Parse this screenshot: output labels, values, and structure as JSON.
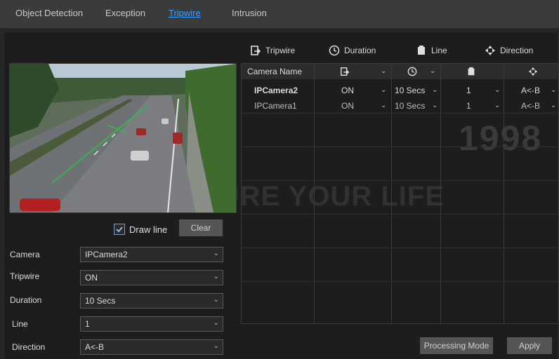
{
  "tabs": [
    "Object Detection",
    "Exception",
    "Tripwire",
    "Intrusion"
  ],
  "active_tab": "Tripwire",
  "draw_line": {
    "label": "Draw line",
    "checked": true
  },
  "clear_label": "Clear",
  "form": {
    "camera": {
      "label": "Camera",
      "value": "IPCamera2"
    },
    "tripwire": {
      "label": "Tripwire",
      "value": "ON"
    },
    "duration": {
      "label": "Duration",
      "value": "10 Secs"
    },
    "line": {
      "label": "Line",
      "value": "1"
    },
    "direction": {
      "label": "Direction",
      "value": "A<-B"
    }
  },
  "columns": {
    "tripwire": "Tripwire",
    "duration": "Duration",
    "line": "Line",
    "direction": "Direction"
  },
  "table": {
    "camera_name_header": "Camera Name",
    "rows": [
      {
        "camera": "IPCamera2",
        "tripwire": "ON",
        "duration": "10 Secs",
        "line": "1",
        "direction": "A<-B"
      },
      {
        "camera": "IPCamera1",
        "tripwire": "ON",
        "duration": "10 Secs",
        "line": "1",
        "direction": "A<-B"
      }
    ]
  },
  "buttons": {
    "processing_mode": "Processing Mode",
    "apply": "Apply"
  },
  "watermark": {
    "year": "1998",
    "slogan": "WE SECURE YOUR LIFE"
  },
  "colors": {
    "active_tab": "#3aa0ff",
    "background": "#1d1d1f",
    "topbar": "#3a3b3d"
  },
  "icons": [
    "tripwire-icon",
    "clock-icon",
    "line-icon",
    "direction-icon"
  ]
}
